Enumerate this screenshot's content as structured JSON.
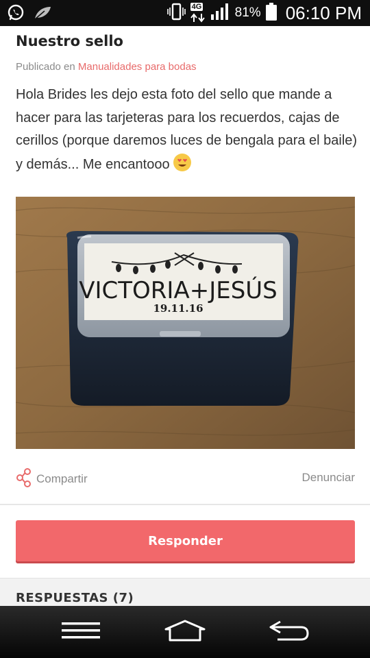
{
  "status_bar": {
    "network_type": "4G",
    "battery_percent": "81%",
    "time": "06:10 PM",
    "icons": [
      "whatsapp-icon",
      "feather-icon",
      "vibrate-icon",
      "network-4g-icon",
      "signal-icon",
      "battery-icon"
    ]
  },
  "post": {
    "title": "Nuestro sello",
    "published_prefix": "Publicado en",
    "category": "Manualidades para bodas",
    "body": "Hola Brides les dejo esta foto del sello que mande a hacer para las tarjeteras para los recuerdos, cajas de cerillos (porque daremos luces de bengala para el baile) y demás... Me encantooo",
    "emoji": "heart-eyes-emoji-icon"
  },
  "photo": {
    "stamp_names": "VICTORIA+JESÚS",
    "stamp_date": "19.11.16"
  },
  "actions": {
    "share_label": "Compartir",
    "report_label": "Denunciar"
  },
  "reply_button": {
    "label": "Responder"
  },
  "responses": {
    "title": "RESPUESTAS (7)"
  },
  "nav_bar": {
    "icons": [
      "menu-icon",
      "home-icon",
      "back-icon"
    ]
  },
  "colors": {
    "accent": "#f2686b",
    "category_link": "#e86a6a",
    "status_bar": "#0f0f0f"
  }
}
